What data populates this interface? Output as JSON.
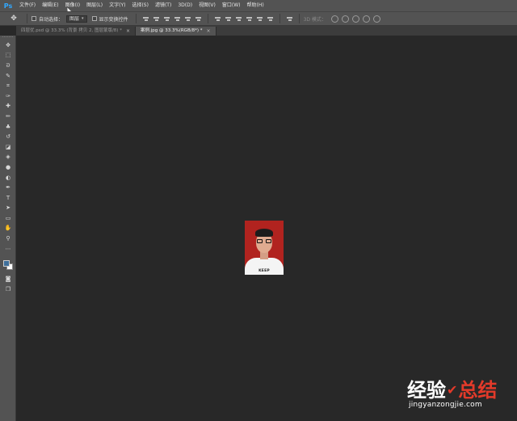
{
  "app": {
    "logo": "Ps",
    "accent": "#31a8ff"
  },
  "menu": [
    {
      "label": "文件(F)"
    },
    {
      "label": "编辑(E)"
    },
    {
      "label": "图像(I)"
    },
    {
      "label": "图层(L)"
    },
    {
      "label": "文字(Y)"
    },
    {
      "label": "选择(S)"
    },
    {
      "label": "滤镜(T)"
    },
    {
      "label": "3D(D)"
    },
    {
      "label": "视图(V)"
    },
    {
      "label": "窗口(W)"
    },
    {
      "label": "帮助(H)"
    }
  ],
  "options": {
    "auto_select_label": "自动选择：",
    "auto_select_value": "图层",
    "show_transform_label": "显示变换控件",
    "mode3d_label": "3D 模式："
  },
  "tabs": [
    {
      "label": "四层优.psd @ 33.3% (背景 拷贝 2, 图层蒙版/8) *",
      "close": "×",
      "active": false
    },
    {
      "label": "案例.jpg @ 33.3%(RGB/8*) *",
      "close": "×",
      "active": true
    }
  ],
  "tools": [
    {
      "icon": "move-tool-icon",
      "glyph": "✥"
    },
    {
      "icon": "marquee-tool-icon",
      "glyph": "⬚"
    },
    {
      "icon": "lasso-tool-icon",
      "glyph": "ᘐ"
    },
    {
      "icon": "quick-select-tool-icon",
      "glyph": "✎"
    },
    {
      "icon": "crop-tool-icon",
      "glyph": "⌗"
    },
    {
      "icon": "eyedropper-tool-icon",
      "glyph": "✑"
    },
    {
      "icon": "healing-brush-tool-icon",
      "glyph": "✚"
    },
    {
      "icon": "brush-tool-icon",
      "glyph": "✏"
    },
    {
      "icon": "clone-stamp-tool-icon",
      "glyph": "♣"
    },
    {
      "icon": "history-brush-tool-icon",
      "glyph": "↺"
    },
    {
      "icon": "eraser-tool-icon",
      "glyph": "◪"
    },
    {
      "icon": "gradient-tool-icon",
      "glyph": "◈"
    },
    {
      "icon": "blur-tool-icon",
      "glyph": "●"
    },
    {
      "icon": "dodge-tool-icon",
      "glyph": "◐"
    },
    {
      "icon": "pen-tool-icon",
      "glyph": "✒"
    },
    {
      "icon": "type-tool-icon",
      "glyph": "T"
    },
    {
      "icon": "path-select-tool-icon",
      "glyph": "➤"
    },
    {
      "icon": "shape-tool-icon",
      "glyph": "▭"
    },
    {
      "icon": "hand-tool-icon",
      "glyph": "✋"
    },
    {
      "icon": "zoom-tool-icon",
      "glyph": "⚲"
    },
    {
      "icon": "more-tools-icon",
      "glyph": "⋯"
    }
  ],
  "tools_bottom": [
    {
      "icon": "quick-mask-icon",
      "glyph": "◙"
    },
    {
      "icon": "screen-mode-icon",
      "glyph": "❐"
    }
  ],
  "colors": {
    "foreground": "#3f6f9a",
    "background": "#ffffff"
  },
  "photo": {
    "shirt_text": "KEEP"
  },
  "watermark": {
    "cn_part1": "经验",
    "cn_part2": "总结",
    "check": "✔",
    "url": "jingyanzongjie.com"
  }
}
